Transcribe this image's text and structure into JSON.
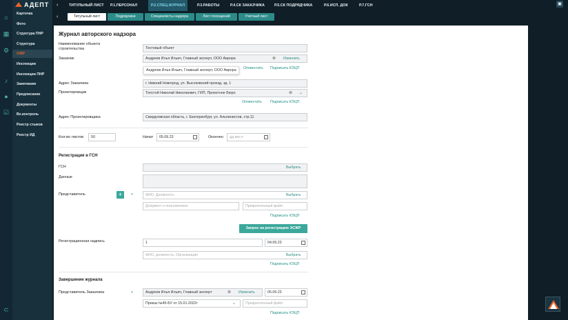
{
  "brand": "АДЕПТ",
  "sidebar": {
    "items": [
      {
        "label": "Карточка",
        "active": false
      },
      {
        "label": "Фото",
        "active": false
      },
      {
        "label": "Структура ПНР",
        "active": false
      },
      {
        "label": "Структура",
        "active": false
      },
      {
        "label": "ОЖР",
        "active": true
      },
      {
        "label": "Инспекции",
        "active": false
      },
      {
        "label": "Инспекции ПНР",
        "active": false
      },
      {
        "label": "Замечания",
        "active": false
      },
      {
        "label": "Предписание",
        "active": false
      },
      {
        "label": "Документы",
        "active": false
      },
      {
        "label": "Вх.контроль",
        "active": false
      },
      {
        "label": "Реестр стыков",
        "active": false
      },
      {
        "label": "Реестр ИД",
        "active": false
      }
    ]
  },
  "topnav": {
    "tabs": [
      {
        "label": "ТИТУЛЬНЫЙ ЛИСТ",
        "active": false
      },
      {
        "label": "Р.1.ПЕРСОНАЛ",
        "active": false
      },
      {
        "label": "Р.2.СПЕЦ.ЖУРНАЛ",
        "active": true
      },
      {
        "label": "Р.3.РАБОТЫ",
        "active": false
      },
      {
        "label": "Р.4.СК ЗАКАЗЧИКА",
        "active": false
      },
      {
        "label": "Р.5.СК ПОДРЯДЧИКА",
        "active": false
      },
      {
        "label": "Р.6.ИСП. ДОК",
        "active": false
      },
      {
        "label": "Р.7.ГСН",
        "active": false
      }
    ]
  },
  "subnav": {
    "tabs": [
      {
        "label": "Титульный лист",
        "active": true
      },
      {
        "label": "Подрядчики",
        "active": false
      },
      {
        "label": "Специалисты надзора",
        "active": false
      },
      {
        "label": "Лист посещений",
        "active": false
      },
      {
        "label": "Учетный лист",
        "active": false
      }
    ]
  },
  "form": {
    "title": "Журнал авторского надзора",
    "object_label": "Наименование объекта строительства",
    "object_value": "Тестовый объект",
    "customer_label": "Заказчик",
    "customer_value": "Андреев Илья Ильич, Главный эксперт, ООО Аврора",
    "change_label": "Изменить",
    "tooltip": "Андреев Илья Ильич, Главный эксперт, ООО Аврора",
    "notify_label": "Оповестить",
    "sign_label": "Подписать КЭЦП",
    "customer_address_label": "Адрес Заказчика",
    "customer_address_value": "г. Нижний Новгород, ул. Высоковский проезд, зд. 1",
    "designer_label": "Проектировщик",
    "designer_value": "Толстой Николай Николаевич, ГИП, Проектное Бюро",
    "designer_address_label": "Адрес Проектировщика",
    "designer_address_value": "Свердловская область, г. Екатеринбург, ул. Альпинистов, стр.11",
    "sheets_label": "Кол-во листов",
    "sheets_value": "50",
    "start_label": "Начат",
    "start_value": "05.09.23",
    "end_label": "Окончен",
    "end_placeholder": "дд.мм.гг",
    "gsn_section": "Регистрация в ГСН",
    "gsn_label": "ГСН",
    "select_label": "Выбрать",
    "data_label": "Данные",
    "rep_label": "Представитель",
    "rep_placeholder": "ФИО, Должность",
    "authority_placeholder": "Документ о полномочиях",
    "attached_placeholder": "Прикрепленный файл",
    "esign_button": "Запрос на регистрацию ЭСЖР",
    "reg_label": "Регистрационная надпись",
    "reg_number": "1",
    "reg_date": "04.09.23",
    "reg_person_placeholder": "ФИО, должность, Организация",
    "close_section": "Завершение журнала",
    "close_rep_label": "Представитель Заказчика",
    "close_rep_value": "Андреев Илья Ильич, Главный эксперт",
    "close_date": "05.09.23",
    "order_value": "Приказ №45-БУ от 15.01.2022г"
  }
}
